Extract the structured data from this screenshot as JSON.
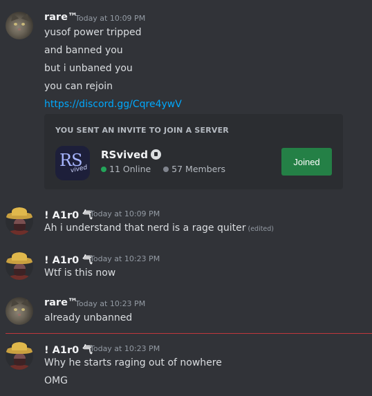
{
  "messages": [
    {
      "author": "rare™",
      "timestamp": "Today at 10:09 PM",
      "lines": [
        "yusof power tripped",
        "and banned you",
        "but i unbaned you",
        "you can rejoin"
      ],
      "link": "https://discord.gg/Cqre4ywV",
      "invite": {
        "header": "YOU SENT AN INVITE TO JOIN A SERVER",
        "server_icon_text": "RS",
        "server_icon_subtext": "vived",
        "server_name": "RSvived",
        "online": "11 Online",
        "members": "57 Members",
        "button_label": "Joined"
      }
    },
    {
      "author": "! A1r0 气",
      "timestamp": "Today at 10:09 PM",
      "lines": [
        "Ah i understand that nerd is a rage quiter"
      ],
      "edited": "(edited)"
    },
    {
      "author": "! A1r0 气",
      "timestamp": "Today at 10:23 PM",
      "lines": [
        "Wtf is this now"
      ]
    },
    {
      "author": "rare™",
      "timestamp": "Today at 10:23 PM",
      "lines": [
        "already unbanned"
      ]
    },
    {
      "author": "! A1r0 气",
      "timestamp": "Today at 10:23 PM",
      "lines": [
        "Why he starts raging out of nowhere",
        "OMG"
      ]
    }
  ],
  "colors": {
    "background": "#313338",
    "link": "#00a8fc",
    "join_button": "#248046",
    "online_dot": "#23a55a",
    "new_messages_divider": "#c0373d"
  },
  "icons": [
    "cat-avatar",
    "straw-hat-avatar",
    "verified-badge-icon",
    "online-dot-icon",
    "members-dot-icon"
  ]
}
